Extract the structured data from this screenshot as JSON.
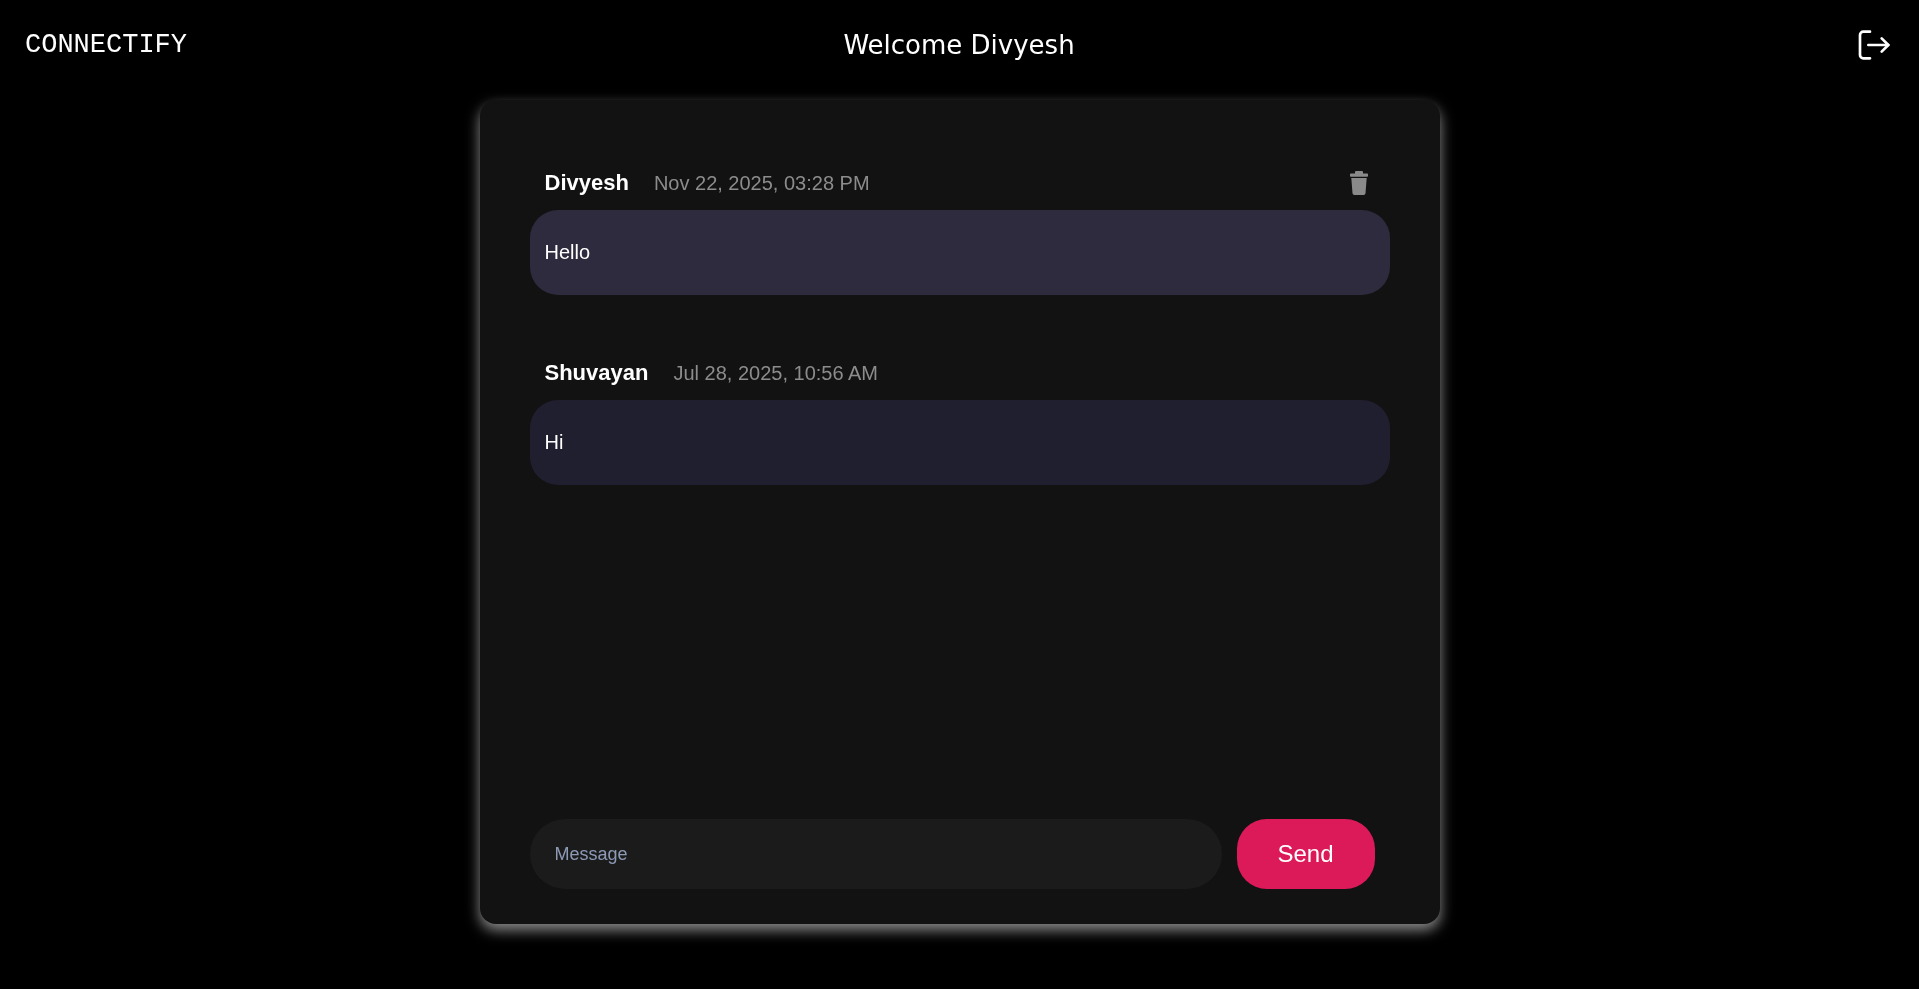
{
  "header": {
    "logo": "CONNECTIFY",
    "title": "Welcome Divyesh"
  },
  "messages": [
    {
      "sender": "Divyesh",
      "time": "Nov 22, 2025, 03:28 PM",
      "text": "Hello",
      "own": true
    },
    {
      "sender": "Shuvayan",
      "time": "Jul 28, 2025, 10:56 AM",
      "text": "Hi",
      "own": false
    }
  ],
  "composer": {
    "placeholder": "Message",
    "button": "Send"
  }
}
